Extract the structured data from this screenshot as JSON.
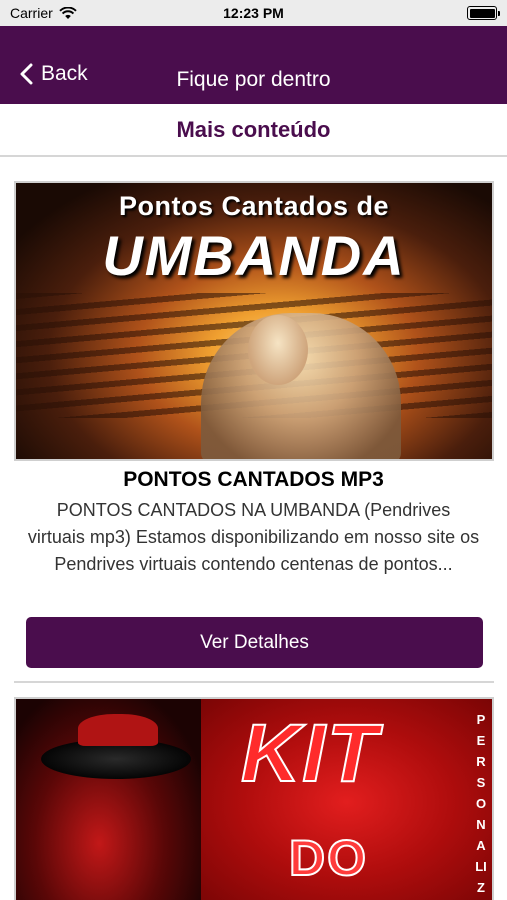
{
  "status_bar": {
    "carrier": "Carrier",
    "time": "12:23 PM"
  },
  "nav": {
    "back_label": "Back",
    "title": "Fique por dentro"
  },
  "section": {
    "title": "Mais conteúdo"
  },
  "cards": [
    {
      "image_line1": "Pontos Cantados de",
      "image_line2": "UMBANDA",
      "title": "PONTOS CANTADOS MP3",
      "description": "PONTOS CANTADOS NA UMBANDA (Pendrives virtuais mp3) Estamos disponibilizando em nosso site os Pendrives virtuais contendo centenas de pontos...",
      "button_label": "Ver Detalhes"
    },
    {
      "image_line1": "KIT",
      "image_line2": "DO",
      "image_vertical": "PERSONALIZ"
    }
  ],
  "colors": {
    "brand": "#4a0d4d",
    "divider": "#d6d6d6"
  }
}
